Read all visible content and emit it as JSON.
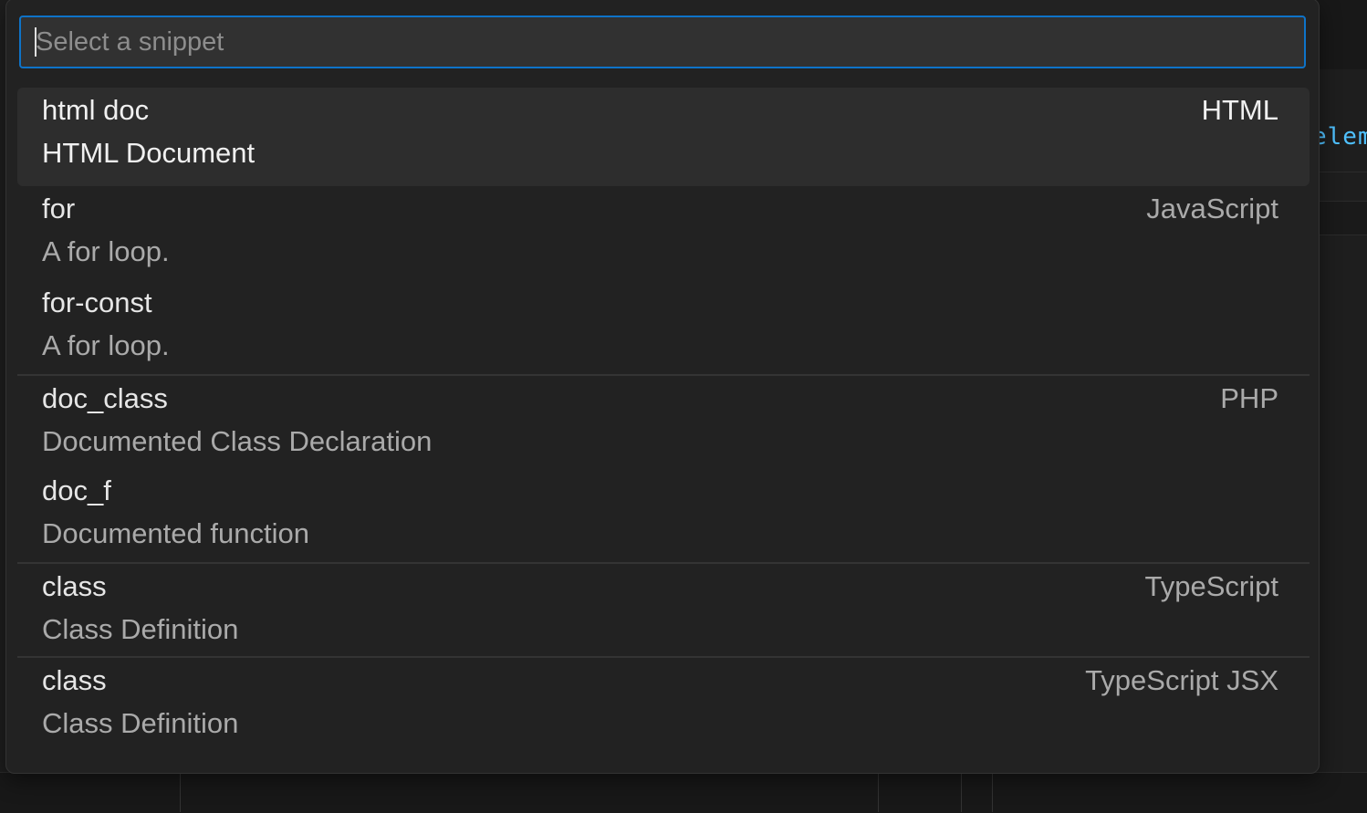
{
  "search": {
    "placeholder": "Select a snippet",
    "value": ""
  },
  "editor": {
    "code_fragment": "elem"
  },
  "snippets": [
    {
      "label": "html doc",
      "description": "HTML Document",
      "group": "HTML",
      "selected": true
    },
    {
      "label": "for",
      "description": "A for loop.",
      "group": "JavaScript"
    },
    {
      "label": "for-const",
      "description": "A for loop.",
      "group": ""
    },
    {
      "label": "doc_class",
      "description": "Documented Class Declaration",
      "group": "PHP"
    },
    {
      "label": "doc_f",
      "description": "Documented function",
      "group": ""
    },
    {
      "label": "class",
      "description": "Class Definition",
      "group": "TypeScript"
    },
    {
      "label": "class",
      "description": "Class Definition",
      "group": "TypeScript JSX"
    }
  ],
  "colors": {
    "accent_focus_border": "#0e73c8",
    "selected_row": "#2d2d2d",
    "panel_background": "#222222"
  }
}
